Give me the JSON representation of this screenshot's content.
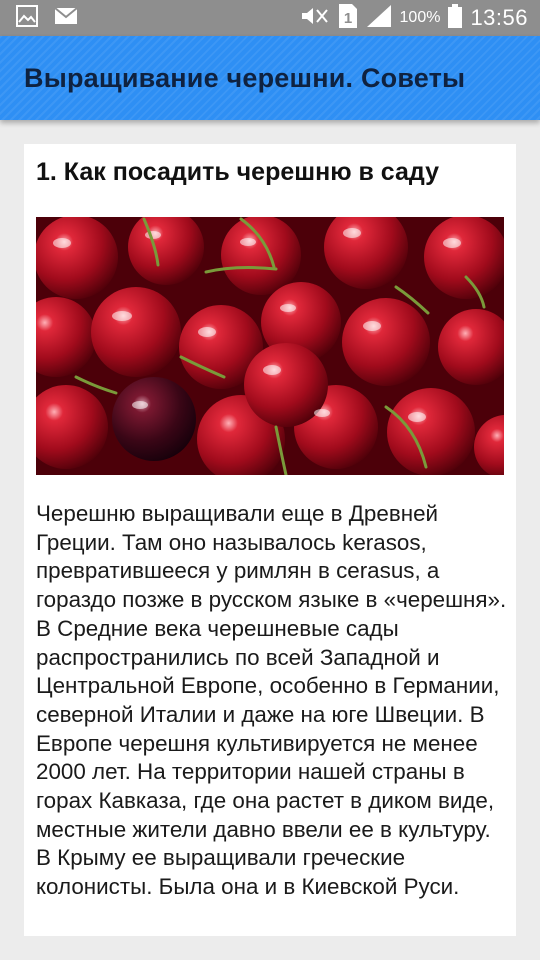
{
  "status_bar": {
    "battery_percent": "100%",
    "time": "13:56",
    "sim_slot": "1",
    "icons": [
      "gallery-icon",
      "mail-icon",
      "mute-icon",
      "sim-icon",
      "signal-icon",
      "battery-icon"
    ]
  },
  "app_bar": {
    "title": "Выращивание черешни. Советы",
    "color": "#2e8ff4"
  },
  "article": {
    "title": "1. Как посадить черешню в саду",
    "image": "cherries-photo",
    "body": "Черешню выращивали еще в Древней Греции. Там оно называлось kerasos, превратившееся у римлян в cerasus, а гораздо позже в русском языке в «черешня». В Средние века черешневые сады распространились по всей Западной и Центральной Европе, особенно в Германии, северной Италии и даже на юге Швеции. В Европе черешня культивируется не менее 2000 лет. На территории нашей страны в горах Кавказа, где она растет в диком виде, местные жители давно ввели ее в культуру. В Крыму ее выращивали греческие колонисты. Была она и в Киевской Руси."
  }
}
